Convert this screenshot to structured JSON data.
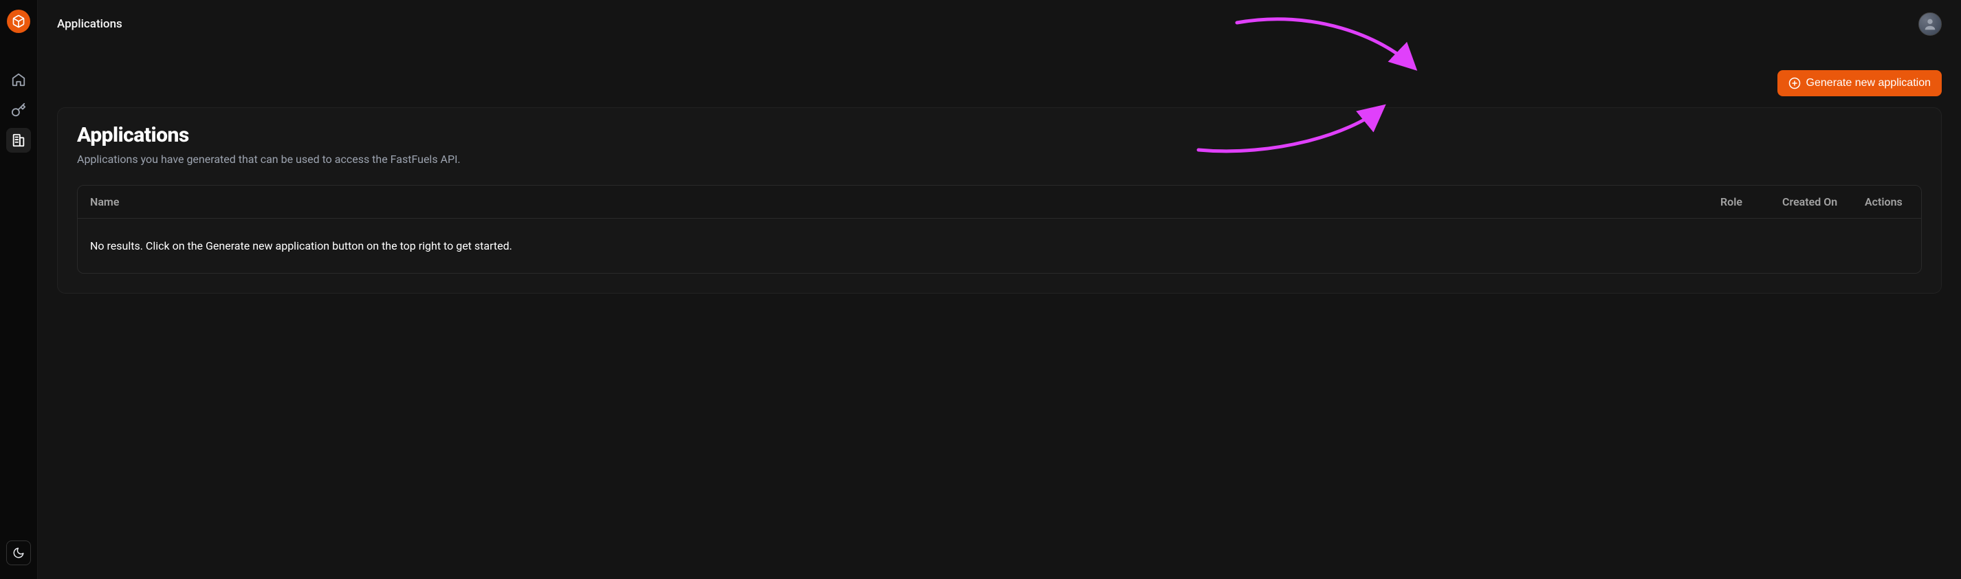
{
  "header": {
    "breadcrumb": "Applications"
  },
  "actions": {
    "generate_label": "Generate new application"
  },
  "card": {
    "title": "Applications",
    "subtitle": "Applications you have generated that can be used to access the FastFuels API."
  },
  "table": {
    "columns": {
      "name": "Name",
      "role": "Role",
      "created_on": "Created On",
      "actions": "Actions"
    },
    "empty_message": "No results. Click on the Generate new application button on the top right to get started."
  },
  "colors": {
    "accent": "#ea580c",
    "annotation": "#e040fb"
  }
}
